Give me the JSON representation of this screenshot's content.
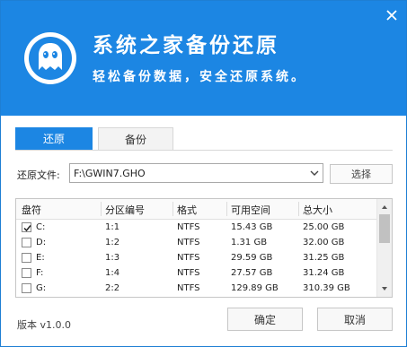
{
  "window": {
    "title": "系统之家备份还原",
    "slogan": "轻松备份数据，安全还原系统。",
    "brand_color": "#1c86e3"
  },
  "icons": {
    "close": "close-icon",
    "logo": "ghost-logo-icon",
    "dropdown": "chevron-down-icon",
    "check": "checkmark-icon",
    "scroll_up": "scroll-up-arrow-icon",
    "scroll_down": "scroll-down-arrow-icon"
  },
  "tabs": [
    {
      "label": "还原",
      "active": true
    },
    {
      "label": "备份",
      "active": false
    }
  ],
  "file": {
    "label": "还原文件:",
    "value": "F:\\GWIN7.GHO",
    "browse_label": "选择"
  },
  "table": {
    "headers": [
      "盘符",
      "分区编号",
      "格式",
      "可用空间",
      "总大小"
    ],
    "rows": [
      {
        "drive": "C:",
        "partition": "1:1",
        "format": "NTFS",
        "free": "15.43 GB",
        "total": "25.00 GB",
        "checked": true
      },
      {
        "drive": "D:",
        "partition": "1:2",
        "format": "NTFS",
        "free": "1.31 GB",
        "total": "32.00 GB",
        "checked": false
      },
      {
        "drive": "E:",
        "partition": "1:3",
        "format": "NTFS",
        "free": "29.59 GB",
        "total": "31.25 GB",
        "checked": false
      },
      {
        "drive": "F:",
        "partition": "1:4",
        "format": "NTFS",
        "free": "27.57 GB",
        "total": "31.24 GB",
        "checked": false
      },
      {
        "drive": "G:",
        "partition": "2:2",
        "format": "NTFS",
        "free": "129.89 GB",
        "total": "310.39 GB",
        "checked": false
      }
    ]
  },
  "footer": {
    "version": "版本 v1.0.0",
    "ok_label": "确定",
    "cancel_label": "取消"
  }
}
